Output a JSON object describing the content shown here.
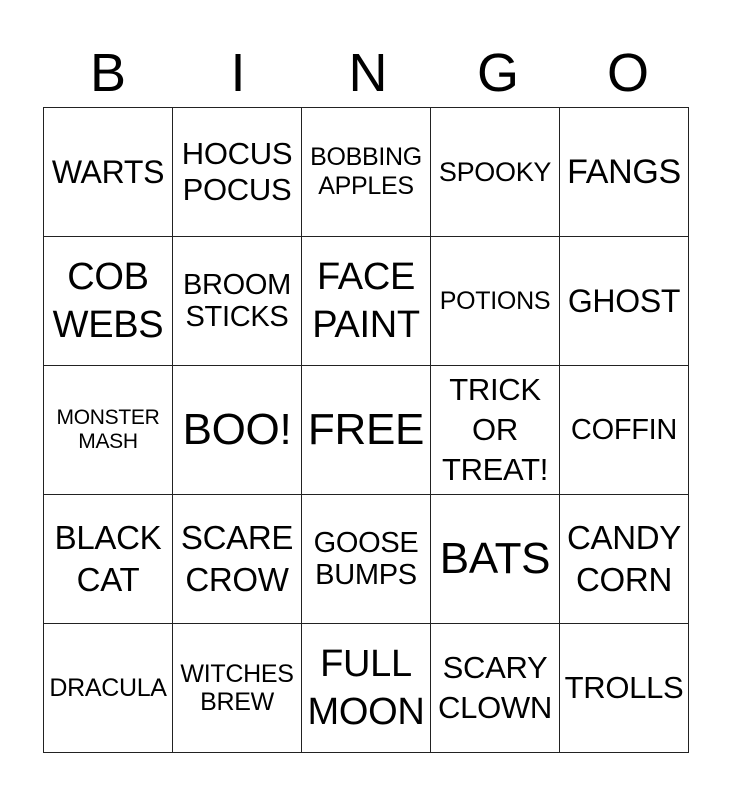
{
  "header": {
    "letters": [
      "B",
      "I",
      "N",
      "G",
      "O"
    ]
  },
  "grid": {
    "rows": [
      [
        "WARTS",
        "HOCUS\nPOCUS",
        "BOBBING\nAPPLES",
        "SPOOKY",
        "FANGS"
      ],
      [
        "COB\nWEBS",
        "BROOM\nSTICKS",
        "FACE\nPAINT",
        "POTIONS",
        "GHOST"
      ],
      [
        "MONSTER\nMASH",
        "BOO!",
        "FREE",
        "TRICK\nOR\nTREAT!",
        "COFFIN"
      ],
      [
        "BLACK\nCAT",
        "SCARE\nCROW",
        "GOOSE\nBUMPS",
        "BATS",
        "CANDY\nCORN"
      ],
      [
        "DRACULA",
        "WITCHES\nBREW",
        "FULL\nMOON",
        "SCARY\nCLOWN",
        "TROLLS"
      ]
    ]
  }
}
